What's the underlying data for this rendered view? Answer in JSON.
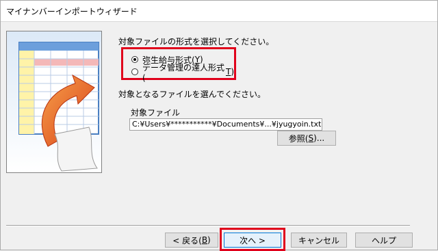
{
  "window": {
    "title": "マイナンバーインポートウィザード"
  },
  "form": {
    "format_prompt": "対象ファイルの形式を選択してください。",
    "format_options": [
      {
        "label": "弥生給与形式(",
        "mnemonic": "Y",
        "suffix": ")",
        "selected": true
      },
      {
        "label": "データ管理の達人形式(",
        "mnemonic": "T",
        "suffix": ")",
        "selected": false
      }
    ],
    "file_prompt": "対象となるファイルを選んでください。",
    "file_label": "対象ファイル",
    "file_path": "C:¥Users¥***********¥Documents¥...¥jyugyoin.txt",
    "browse": {
      "label": "参照(",
      "mnemonic": "S",
      "suffix": ")..."
    }
  },
  "buttons": {
    "back": {
      "label": "< 戻る(",
      "mnemonic": "B",
      "suffix": ")"
    },
    "next": {
      "label": "次へ >"
    },
    "cancel": {
      "label": "キャンセル"
    },
    "help": {
      "label": "ヘルプ"
    }
  },
  "colors": {
    "highlight": "#e0001b",
    "arrow": "#e85a1a",
    "dialog_bg": "#f0f0f0"
  }
}
